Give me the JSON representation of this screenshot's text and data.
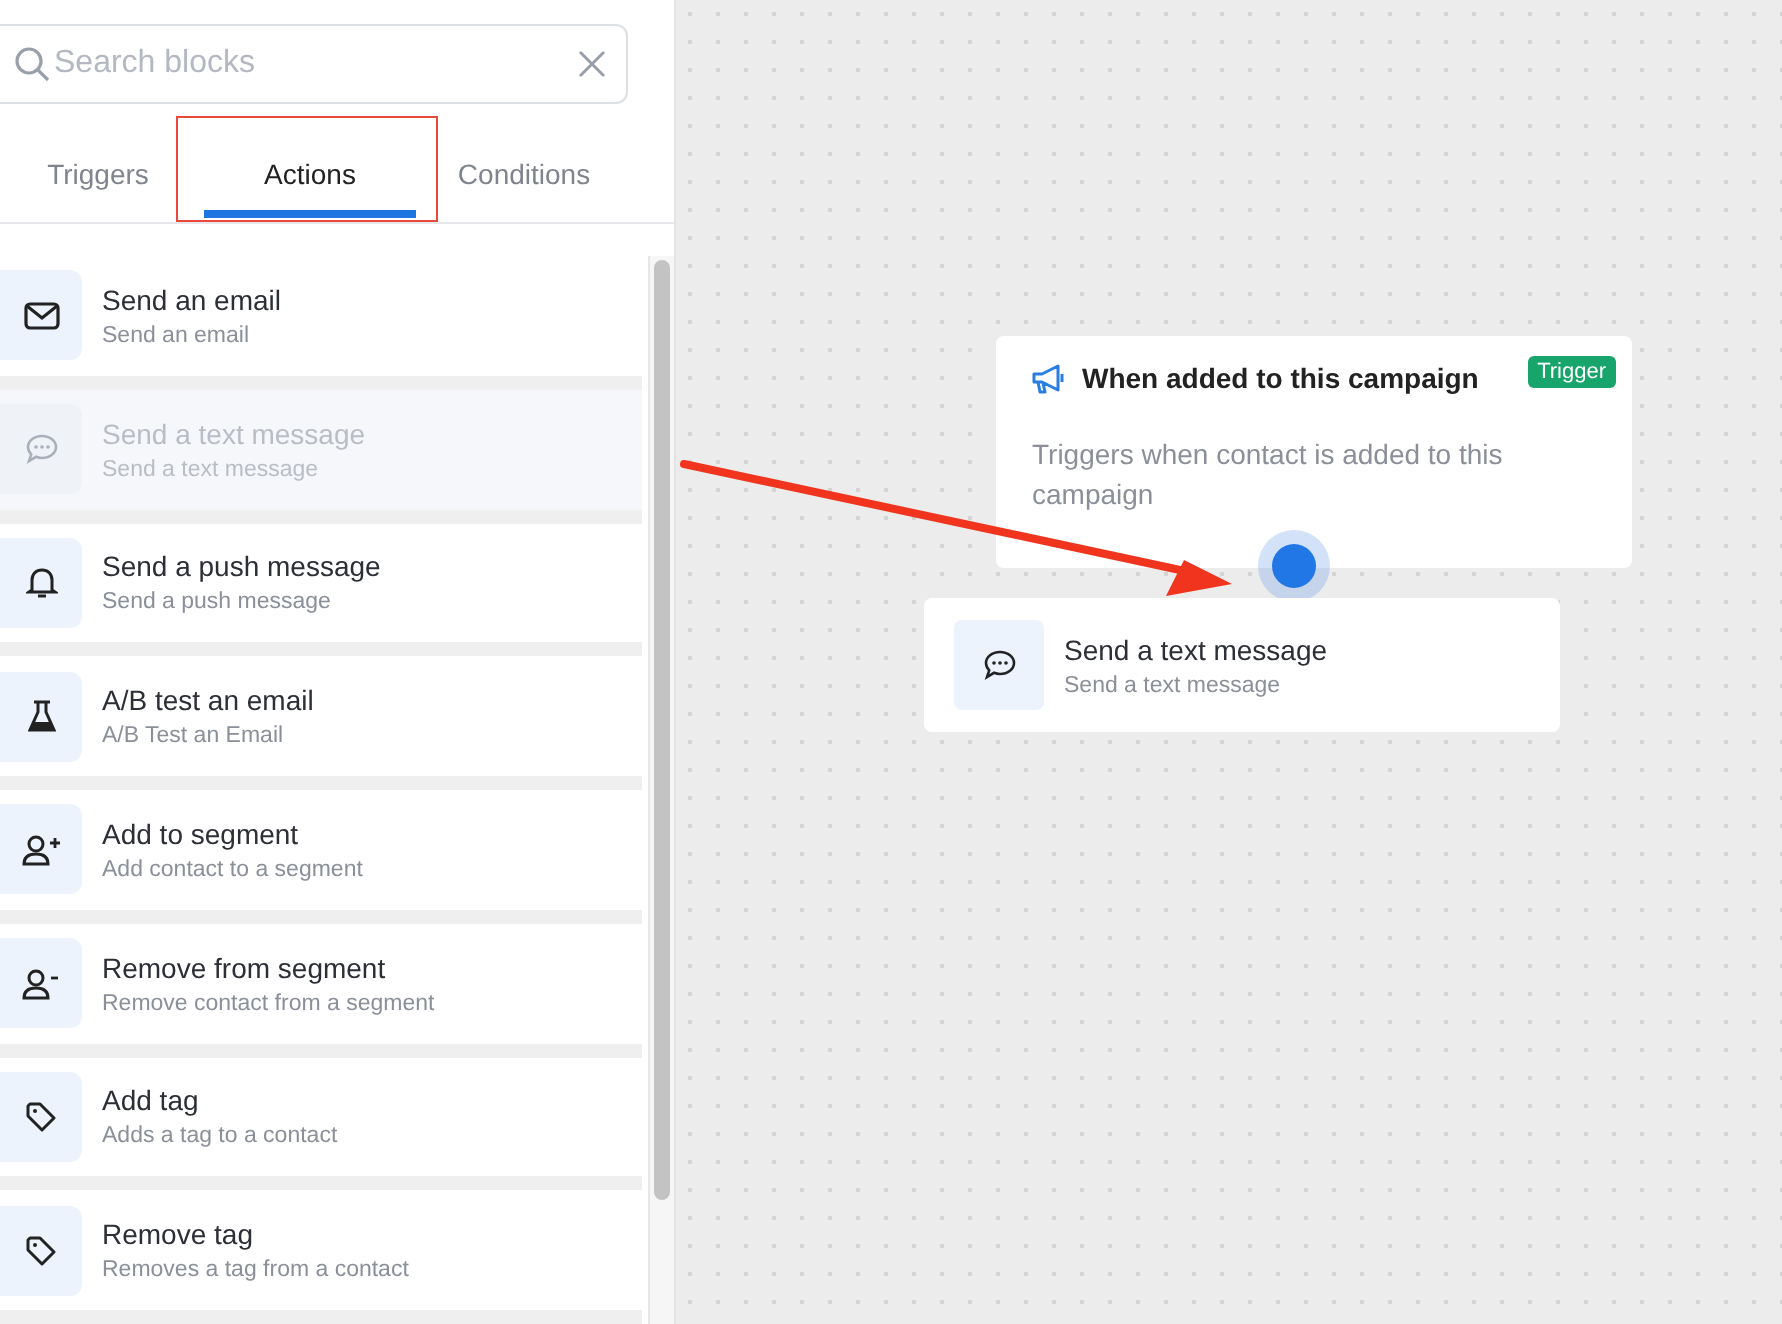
{
  "search": {
    "placeholder": "Search blocks"
  },
  "tabs": [
    {
      "label": "Triggers",
      "selected": false,
      "annotated": false
    },
    {
      "label": "Actions",
      "selected": true,
      "annotated": true
    },
    {
      "label": "Conditions",
      "selected": false,
      "annotated": false
    }
  ],
  "blocks": [
    {
      "kind": "email",
      "title": "Send an email",
      "subtitle": "Send an email",
      "dragging": false
    },
    {
      "kind": "sms",
      "title": "Send a text message",
      "subtitle": "Send a text message",
      "dragging": true
    },
    {
      "kind": "bell",
      "title": "Send a push message",
      "subtitle": "Send a push message",
      "dragging": false
    },
    {
      "kind": "flask",
      "title": "A/B test an email",
      "subtitle": "A/B Test an Email",
      "dragging": false
    },
    {
      "kind": "user-add",
      "title": "Add to segment",
      "subtitle": "Add contact to a segment",
      "dragging": false
    },
    {
      "kind": "user-remove",
      "title": "Remove from segment",
      "subtitle": "Remove contact from a segment",
      "dragging": false
    },
    {
      "kind": "tag",
      "title": "Add tag",
      "subtitle": "Adds a tag to a contact",
      "dragging": false
    },
    {
      "kind": "tag",
      "title": "Remove tag",
      "subtitle": "Removes a tag from a contact",
      "dragging": false
    }
  ],
  "canvas": {
    "trigger_node": {
      "title": "When added to this campaign",
      "badge": "Trigger",
      "description": "Triggers when contact is added to this campaign"
    },
    "dropped_node": {
      "kind": "sms",
      "title": "Send a text message",
      "subtitle": "Send a text message"
    }
  }
}
